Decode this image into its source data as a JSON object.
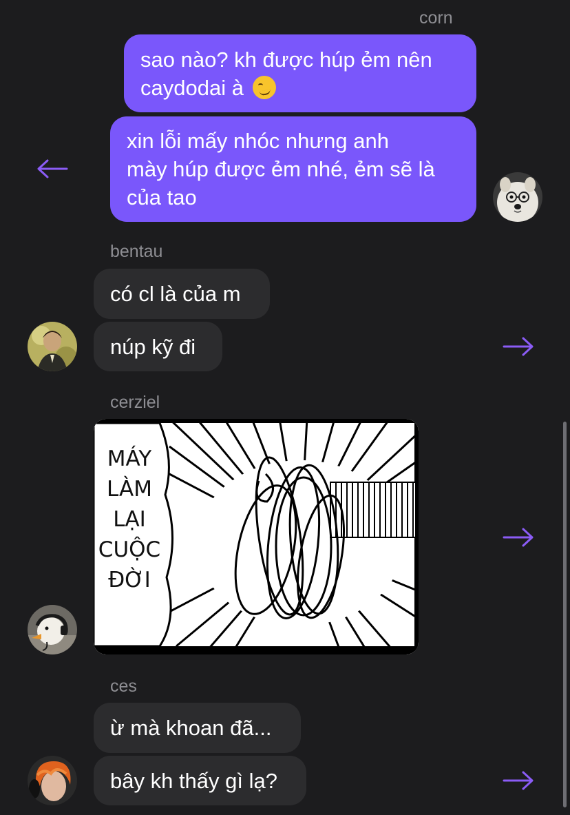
{
  "colors": {
    "background": "#1c1c1e",
    "outgoing_bubble": "#7a57fb",
    "incoming_bubble": "#2c2c2e",
    "arrow": "#8b5cf6",
    "sender_name": "#8e8e93"
  },
  "messages": [
    {
      "sender": "corn",
      "direction": "outgoing",
      "bubbles": [
        {
          "lines": [
            "sao nào? kh được húp ẻm nên",
            "caydodai à"
          ],
          "emoji": "smirking-face"
        },
        {
          "lines": [
            "xin lỗi mấy nhóc nhưng anh",
            "mày húp được ẻm nhé, ẻm sẽ là",
            "của tao"
          ]
        }
      ],
      "avatar": "samoyed-dog-with-glasses",
      "action_icon": "arrow-left-icon"
    },
    {
      "sender": "bentau",
      "direction": "incoming",
      "bubbles": [
        {
          "lines": [
            "có cl là của m"
          ]
        },
        {
          "lines": [
            "núp kỹ đi"
          ]
        }
      ],
      "avatar": "person-photo",
      "action_icon": "arrow-right-icon"
    },
    {
      "sender": "cerziel",
      "direction": "incoming",
      "image": {
        "description_icon": "manga-noose-panel",
        "lettering": [
          "MÁY",
          "LÀM",
          "LẠI",
          "CUỘC",
          "ĐỜI"
        ]
      },
      "avatar": "goose-with-headset",
      "action_icon": "arrow-right-icon"
    },
    {
      "sender": "ces",
      "direction": "incoming",
      "bubbles": [
        {
          "lines": [
            "ừ mà khoan đã..."
          ]
        },
        {
          "lines": [
            "bây kh thấy gì lạ?"
          ]
        }
      ],
      "avatar": "orange-hair-person",
      "action_icon": "arrow-right-icon"
    }
  ]
}
